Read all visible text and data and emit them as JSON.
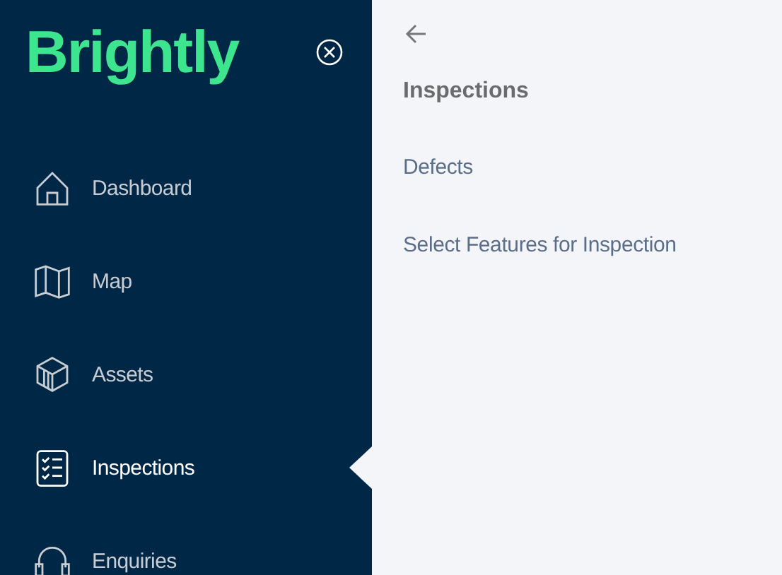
{
  "sidebar": {
    "logo": "Brightly",
    "items": [
      {
        "label": "Dashboard",
        "kind": "home",
        "selected": false
      },
      {
        "label": "Map",
        "kind": "map",
        "selected": false
      },
      {
        "label": "Assets",
        "kind": "box",
        "selected": false
      },
      {
        "label": "Inspections",
        "kind": "checklist",
        "selected": true
      },
      {
        "label": "Enquiries",
        "kind": "headset",
        "selected": false
      }
    ]
  },
  "panel": {
    "title": "Inspections",
    "items": [
      {
        "label": "Defects"
      },
      {
        "label": "Select Features for Inspection"
      }
    ]
  }
}
